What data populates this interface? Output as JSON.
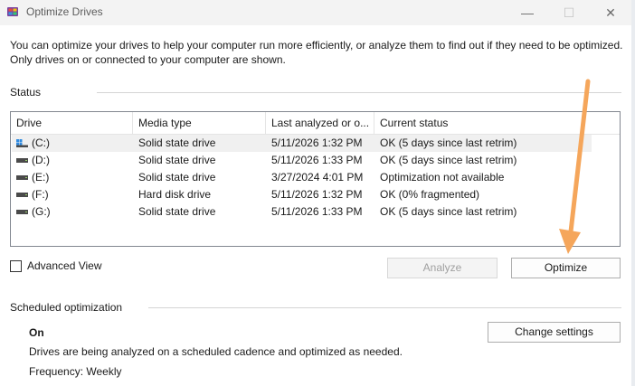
{
  "window": {
    "title": "Optimize Drives",
    "minimize_glyph": "—",
    "maximize_glyph": "☐",
    "close_glyph": "✕"
  },
  "intro": {
    "text": "You can optimize your drives to help your computer run more efficiently, or analyze them to find out if they need to be optimized. Only drives on or connected to your computer are shown."
  },
  "status": {
    "label": "Status",
    "columns": [
      "Drive",
      "Media type",
      "Last analyzed or o...",
      "Current status"
    ],
    "drives": [
      {
        "drive": "(C:)",
        "media": "Solid state drive",
        "last": "5/11/2026 1:32 PM",
        "status": "OK (5 days since last retrim)",
        "icon": "windows-drive-icon",
        "selected": true
      },
      {
        "drive": "(D:)",
        "media": "Solid state drive",
        "last": "5/11/2026 1:33 PM",
        "status": "OK (5 days since last retrim)",
        "icon": "drive-icon",
        "selected": false
      },
      {
        "drive": "(E:)",
        "media": "Solid state drive",
        "last": "3/27/2024 4:01 PM",
        "status": "Optimization not available",
        "icon": "drive-icon",
        "selected": false
      },
      {
        "drive": "(F:)",
        "media": "Hard disk drive",
        "last": "5/11/2026 1:32 PM",
        "status": "OK (0% fragmented)",
        "icon": "drive-icon",
        "selected": false
      },
      {
        "drive": "(G:)",
        "media": "Solid state drive",
        "last": "5/11/2026 1:33 PM",
        "status": "OK (5 days since last retrim)",
        "icon": "drive-icon",
        "selected": false
      }
    ]
  },
  "controls": {
    "advanced_view_label": "Advanced View",
    "advanced_view_checked": false,
    "analyze_label": "Analyze",
    "analyze_enabled": false,
    "optimize_label": "Optimize"
  },
  "scheduled": {
    "label": "Scheduled optimization",
    "state": "On",
    "description": "Drives are being analyzed on a scheduled cadence and optimized as needed.",
    "frequency": "Frequency: Weekly",
    "change_label": "Change settings"
  },
  "colors": {
    "annotation_arrow": "#f5a65b",
    "selected_row": "#f0f0f0",
    "windows_blue": "#0078d4"
  }
}
